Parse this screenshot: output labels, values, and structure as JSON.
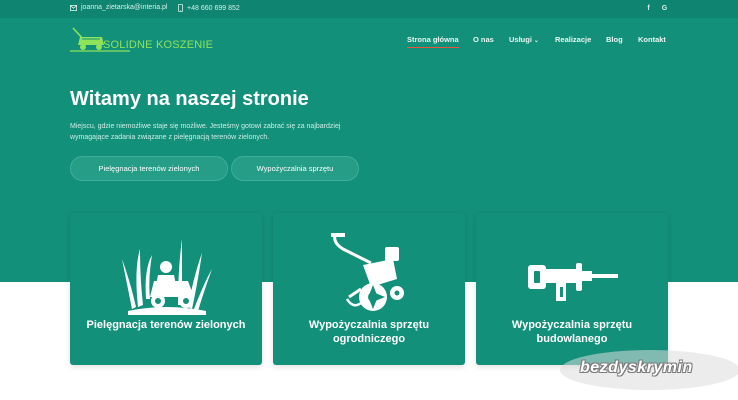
{
  "topbar": {
    "email": "joanna_zietarska@interia.pl",
    "phone": "+48 660 699 852",
    "social": [
      {
        "icon": "facebook-icon",
        "glyph": "f"
      },
      {
        "icon": "google-icon",
        "glyph": "G"
      }
    ]
  },
  "logo": {
    "text": "SOLIDNE KOSZENIE"
  },
  "nav": {
    "items": [
      {
        "label": "Strona główna",
        "active": true
      },
      {
        "label": "O nas"
      },
      {
        "label": "Usługi",
        "has_dropdown": true
      },
      {
        "label": "Realizacje"
      },
      {
        "label": "Blog"
      },
      {
        "label": "Kontakt"
      }
    ],
    "dropdown_caret": "⌄"
  },
  "hero": {
    "title": "Witamy na naszej stronie",
    "description": "Miejscu, gdzie niemożliwe staje się możliwe. Jesteśmy gotowi zabrać się za najbardziej wymagające zadania związane z pielęgnacją terenów zielonych.",
    "buttons": [
      "Pielęgnacja terenów zielonych",
      "Wypożyczalnia sprzętu"
    ]
  },
  "cards": [
    {
      "label": "Pielęgnacja terenów zielonych",
      "icon": "lawn-mower-icon"
    },
    {
      "label": "Wypożyczalnia sprzętu ogrodniczego",
      "icon": "tiller-icon"
    },
    {
      "label": "Wypożyczalnia sprzętu budowlanego",
      "icon": "drill-icon"
    }
  ],
  "watermark": {
    "text": "bezdyskrymin"
  },
  "colors": {
    "primary": "#13907a",
    "topbar": "#0f8470",
    "logo_green": "#8fe35a",
    "active_underline": "#e8553e"
  }
}
